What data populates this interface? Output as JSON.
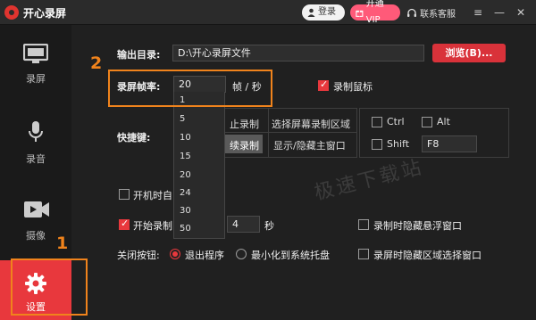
{
  "app": {
    "title": "开心录屏",
    "login_label": "登录",
    "vip_label": "开通VIP",
    "service_label": "联系客服"
  },
  "sidebar": {
    "items": [
      {
        "label": "录屏",
        "icon": "monitor-icon"
      },
      {
        "label": "录音",
        "icon": "microphone-icon"
      },
      {
        "label": "摄像",
        "icon": "camera-icon"
      },
      {
        "label": "设置",
        "icon": "gear-icon",
        "active": true
      }
    ]
  },
  "settings": {
    "output_dir_label": "输出目录:",
    "output_dir_value": "D:\\开心录屏文件",
    "browse_label": "浏览(B)...",
    "framerate_label": "录屏帧率:",
    "framerate_value": "20",
    "framerate_unit": "帧 / 秒",
    "record_mouse_label": "录制鼠标",
    "hotkeys_label": "快捷键:",
    "hotkey_actions": [
      "止录制",
      "选择屏幕录制区域",
      "续录制",
      "显示/隐藏主窗口"
    ],
    "modifier_keys": [
      "Ctrl",
      "Alt",
      "Shift"
    ],
    "hotkey_value": "F8",
    "startup_label": "开机时自",
    "start_record_label": "开始录制",
    "start_record_value": "4",
    "seconds_unit": "秒",
    "hide_float_label": "录制时隐藏悬浮窗口",
    "hide_region_label": "录屏时隐藏区域选择窗口",
    "close_button_label": "关闭按钮:",
    "close_exit_label": "退出程序",
    "close_minimize_label": "最小化到系统托盘"
  },
  "framerate_options": [
    "1",
    "5",
    "10",
    "15",
    "20",
    "24",
    "30",
    "50"
  ],
  "annotations": [
    "1",
    "2"
  ],
  "watermark": "极速下载站",
  "colors": {
    "accent": "#e8383d",
    "vip": "#ff5a79",
    "annotation": "#f0831c"
  }
}
